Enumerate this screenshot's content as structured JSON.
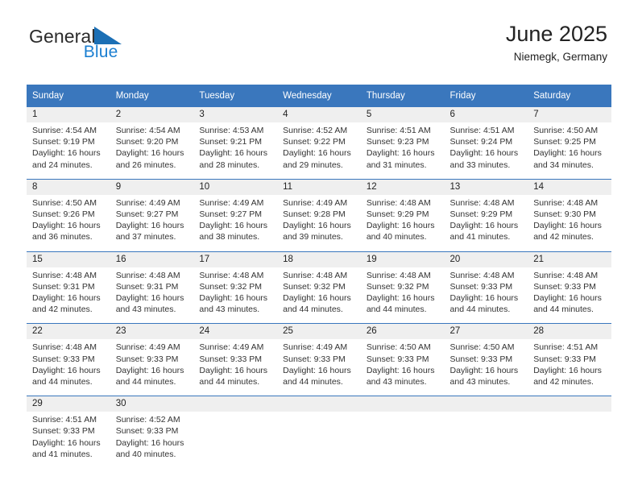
{
  "brand": {
    "name_part1": "General",
    "name_part2": "Blue",
    "triangle_color": "#1b6fb5",
    "blue_color": "#1b7fd1"
  },
  "header": {
    "title": "June 2025",
    "location": "Niemegk, Germany"
  },
  "theme": {
    "header_blue": "#3a77bd",
    "daynum_gray": "#efefef",
    "text_dark": "#222222"
  },
  "weekdays": [
    "Sunday",
    "Monday",
    "Tuesday",
    "Wednesday",
    "Thursday",
    "Friday",
    "Saturday"
  ],
  "labels": {
    "sunrise_prefix": "Sunrise:",
    "sunset_prefix": "Sunset:",
    "daylight_prefix": "Daylight:"
  },
  "weeks": [
    [
      {
        "day": "1",
        "sunrise": "Sunrise: 4:54 AM",
        "sunset": "Sunset: 9:19 PM",
        "daylight1": "Daylight: 16 hours",
        "daylight2": "and 24 minutes."
      },
      {
        "day": "2",
        "sunrise": "Sunrise: 4:54 AM",
        "sunset": "Sunset: 9:20 PM",
        "daylight1": "Daylight: 16 hours",
        "daylight2": "and 26 minutes."
      },
      {
        "day": "3",
        "sunrise": "Sunrise: 4:53 AM",
        "sunset": "Sunset: 9:21 PM",
        "daylight1": "Daylight: 16 hours",
        "daylight2": "and 28 minutes."
      },
      {
        "day": "4",
        "sunrise": "Sunrise: 4:52 AM",
        "sunset": "Sunset: 9:22 PM",
        "daylight1": "Daylight: 16 hours",
        "daylight2": "and 29 minutes."
      },
      {
        "day": "5",
        "sunrise": "Sunrise: 4:51 AM",
        "sunset": "Sunset: 9:23 PM",
        "daylight1": "Daylight: 16 hours",
        "daylight2": "and 31 minutes."
      },
      {
        "day": "6",
        "sunrise": "Sunrise: 4:51 AM",
        "sunset": "Sunset: 9:24 PM",
        "daylight1": "Daylight: 16 hours",
        "daylight2": "and 33 minutes."
      },
      {
        "day": "7",
        "sunrise": "Sunrise: 4:50 AM",
        "sunset": "Sunset: 9:25 PM",
        "daylight1": "Daylight: 16 hours",
        "daylight2": "and 34 minutes."
      }
    ],
    [
      {
        "day": "8",
        "sunrise": "Sunrise: 4:50 AM",
        "sunset": "Sunset: 9:26 PM",
        "daylight1": "Daylight: 16 hours",
        "daylight2": "and 36 minutes."
      },
      {
        "day": "9",
        "sunrise": "Sunrise: 4:49 AM",
        "sunset": "Sunset: 9:27 PM",
        "daylight1": "Daylight: 16 hours",
        "daylight2": "and 37 minutes."
      },
      {
        "day": "10",
        "sunrise": "Sunrise: 4:49 AM",
        "sunset": "Sunset: 9:27 PM",
        "daylight1": "Daylight: 16 hours",
        "daylight2": "and 38 minutes."
      },
      {
        "day": "11",
        "sunrise": "Sunrise: 4:49 AM",
        "sunset": "Sunset: 9:28 PM",
        "daylight1": "Daylight: 16 hours",
        "daylight2": "and 39 minutes."
      },
      {
        "day": "12",
        "sunrise": "Sunrise: 4:48 AM",
        "sunset": "Sunset: 9:29 PM",
        "daylight1": "Daylight: 16 hours",
        "daylight2": "and 40 minutes."
      },
      {
        "day": "13",
        "sunrise": "Sunrise: 4:48 AM",
        "sunset": "Sunset: 9:29 PM",
        "daylight1": "Daylight: 16 hours",
        "daylight2": "and 41 minutes."
      },
      {
        "day": "14",
        "sunrise": "Sunrise: 4:48 AM",
        "sunset": "Sunset: 9:30 PM",
        "daylight1": "Daylight: 16 hours",
        "daylight2": "and 42 minutes."
      }
    ],
    [
      {
        "day": "15",
        "sunrise": "Sunrise: 4:48 AM",
        "sunset": "Sunset: 9:31 PM",
        "daylight1": "Daylight: 16 hours",
        "daylight2": "and 42 minutes."
      },
      {
        "day": "16",
        "sunrise": "Sunrise: 4:48 AM",
        "sunset": "Sunset: 9:31 PM",
        "daylight1": "Daylight: 16 hours",
        "daylight2": "and 43 minutes."
      },
      {
        "day": "17",
        "sunrise": "Sunrise: 4:48 AM",
        "sunset": "Sunset: 9:32 PM",
        "daylight1": "Daylight: 16 hours",
        "daylight2": "and 43 minutes."
      },
      {
        "day": "18",
        "sunrise": "Sunrise: 4:48 AM",
        "sunset": "Sunset: 9:32 PM",
        "daylight1": "Daylight: 16 hours",
        "daylight2": "and 44 minutes."
      },
      {
        "day": "19",
        "sunrise": "Sunrise: 4:48 AM",
        "sunset": "Sunset: 9:32 PM",
        "daylight1": "Daylight: 16 hours",
        "daylight2": "and 44 minutes."
      },
      {
        "day": "20",
        "sunrise": "Sunrise: 4:48 AM",
        "sunset": "Sunset: 9:33 PM",
        "daylight1": "Daylight: 16 hours",
        "daylight2": "and 44 minutes."
      },
      {
        "day": "21",
        "sunrise": "Sunrise: 4:48 AM",
        "sunset": "Sunset: 9:33 PM",
        "daylight1": "Daylight: 16 hours",
        "daylight2": "and 44 minutes."
      }
    ],
    [
      {
        "day": "22",
        "sunrise": "Sunrise: 4:48 AM",
        "sunset": "Sunset: 9:33 PM",
        "daylight1": "Daylight: 16 hours",
        "daylight2": "and 44 minutes."
      },
      {
        "day": "23",
        "sunrise": "Sunrise: 4:49 AM",
        "sunset": "Sunset: 9:33 PM",
        "daylight1": "Daylight: 16 hours",
        "daylight2": "and 44 minutes."
      },
      {
        "day": "24",
        "sunrise": "Sunrise: 4:49 AM",
        "sunset": "Sunset: 9:33 PM",
        "daylight1": "Daylight: 16 hours",
        "daylight2": "and 44 minutes."
      },
      {
        "day": "25",
        "sunrise": "Sunrise: 4:49 AM",
        "sunset": "Sunset: 9:33 PM",
        "daylight1": "Daylight: 16 hours",
        "daylight2": "and 44 minutes."
      },
      {
        "day": "26",
        "sunrise": "Sunrise: 4:50 AM",
        "sunset": "Sunset: 9:33 PM",
        "daylight1": "Daylight: 16 hours",
        "daylight2": "and 43 minutes."
      },
      {
        "day": "27",
        "sunrise": "Sunrise: 4:50 AM",
        "sunset": "Sunset: 9:33 PM",
        "daylight1": "Daylight: 16 hours",
        "daylight2": "and 43 minutes."
      },
      {
        "day": "28",
        "sunrise": "Sunrise: 4:51 AM",
        "sunset": "Sunset: 9:33 PM",
        "daylight1": "Daylight: 16 hours",
        "daylight2": "and 42 minutes."
      }
    ],
    [
      {
        "day": "29",
        "sunrise": "Sunrise: 4:51 AM",
        "sunset": "Sunset: 9:33 PM",
        "daylight1": "Daylight: 16 hours",
        "daylight2": "and 41 minutes."
      },
      {
        "day": "30",
        "sunrise": "Sunrise: 4:52 AM",
        "sunset": "Sunset: 9:33 PM",
        "daylight1": "Daylight: 16 hours",
        "daylight2": "and 40 minutes."
      },
      {
        "day": "",
        "sunrise": "",
        "sunset": "",
        "daylight1": "",
        "daylight2": ""
      },
      {
        "day": "",
        "sunrise": "",
        "sunset": "",
        "daylight1": "",
        "daylight2": ""
      },
      {
        "day": "",
        "sunrise": "",
        "sunset": "",
        "daylight1": "",
        "daylight2": ""
      },
      {
        "day": "",
        "sunrise": "",
        "sunset": "",
        "daylight1": "",
        "daylight2": ""
      },
      {
        "day": "",
        "sunrise": "",
        "sunset": "",
        "daylight1": "",
        "daylight2": ""
      }
    ]
  ]
}
